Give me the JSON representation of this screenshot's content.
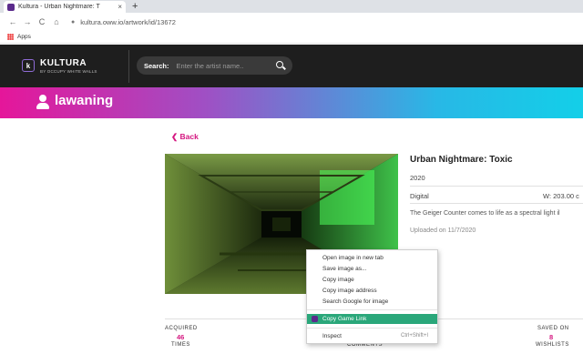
{
  "browser": {
    "tab_title": "Kultura - Urban Nightmare: T",
    "tab_close": "×",
    "new_tab": "+",
    "url": "kultura.oww.io/artwork/id/13672",
    "bookmarks_apps": "Apps",
    "nav_back": "←",
    "nav_forward": "→",
    "nav_reload": "C",
    "nav_home": "⌂",
    "lock": "🔒"
  },
  "header": {
    "logo_letter": "k",
    "logo_name": "KULTURA",
    "logo_sub": "BY OCCUPY WHITE WALLS",
    "search_label": "Search:",
    "search_placeholder": "Enter the artist name.."
  },
  "banner": {
    "username": "lawaning"
  },
  "artwork": {
    "back_label": "Back",
    "title": "Urban Nightmare: Toxic",
    "year": "2020",
    "medium": "Digital",
    "size": "W: 203.00 c",
    "description": "The Geiger Counter comes to life as a spectral light il",
    "uploaded": "Uploaded on 11/7/2020"
  },
  "stats": {
    "acquired_label": "ACQUIRED",
    "acquired_value": "46",
    "times_label": "TIMES",
    "comments_label": "COMMENTS",
    "saved_label": "SAVED ON",
    "saved_value": "8",
    "wishlists_label": "WISHLISTS"
  },
  "context_menu": {
    "items": [
      "Open image in new tab",
      "Save image as...",
      "Copy image",
      "Copy image address",
      "Search Google for image",
      "Copy Game Link",
      "Inspect"
    ],
    "inspect_shortcut": "Ctrl+Shift+I"
  },
  "colors": {
    "accent_pink": "#d4157f",
    "header_bg": "#1e1e1e",
    "menu_highlight": "#2aa77a"
  }
}
